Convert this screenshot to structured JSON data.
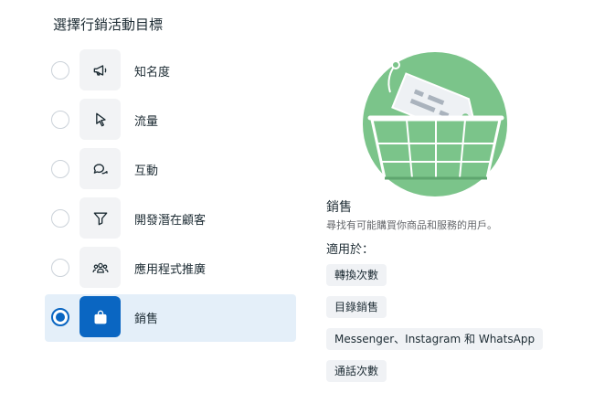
{
  "header": {
    "title": "選擇行銷活動目標"
  },
  "objectives": [
    {
      "label": "知名度",
      "icon": "megaphone-icon",
      "selected": false
    },
    {
      "label": "流量",
      "icon": "cursor-icon",
      "selected": false
    },
    {
      "label": "互動",
      "icon": "chat-bubbles-icon",
      "selected": false
    },
    {
      "label": "開發潛在顧客",
      "icon": "funnel-icon",
      "selected": false
    },
    {
      "label": "應用程式推廣",
      "icon": "people-icon",
      "selected": false
    },
    {
      "label": "銷售",
      "icon": "shopping-bag-icon",
      "selected": true
    }
  ],
  "detail": {
    "title": "銷售",
    "description": "尋找有可能購買你商品和服務的用戶。",
    "applies_label": "適用於：",
    "tags": [
      "轉換次數",
      "目錄銷售",
      "Messenger、Instagram 和 WhatsApp",
      "通話次數"
    ]
  },
  "colors": {
    "accent": "#0a66c2",
    "selected_bg": "#e4eff9",
    "illustration_green": "#7bc48a"
  }
}
